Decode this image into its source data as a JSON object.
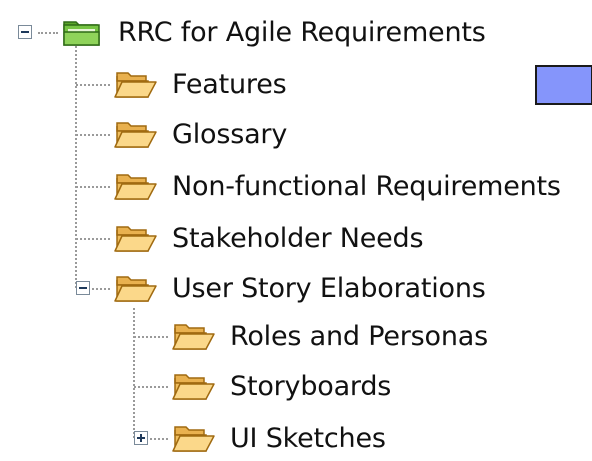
{
  "tree": {
    "root": {
      "label": "RRC for Agile Requirements",
      "icon": "green-folder-icon",
      "expanded": true
    },
    "children": [
      {
        "label": "Features",
        "icon": "open-folder-icon"
      },
      {
        "label": "Glossary",
        "icon": "open-folder-icon"
      },
      {
        "label": "Non-functional Requirements",
        "icon": "open-folder-icon"
      },
      {
        "label": "Stakeholder Needs",
        "icon": "open-folder-icon"
      },
      {
        "label": "User Story Elaborations",
        "icon": "open-folder-icon",
        "expanded": true,
        "children": [
          {
            "label": "Roles and Personas",
            "icon": "open-folder-icon"
          },
          {
            "label": "Storyboards",
            "icon": "open-folder-icon"
          },
          {
            "label": "UI Sketches",
            "icon": "open-folder-icon",
            "expanded": false
          }
        ]
      }
    ]
  },
  "swatch": {
    "color": "#8595fb"
  },
  "colors": {
    "folder_fill": "#f5c46a",
    "folder_stroke": "#b07a16",
    "root_folder": "#6cbf3a"
  }
}
